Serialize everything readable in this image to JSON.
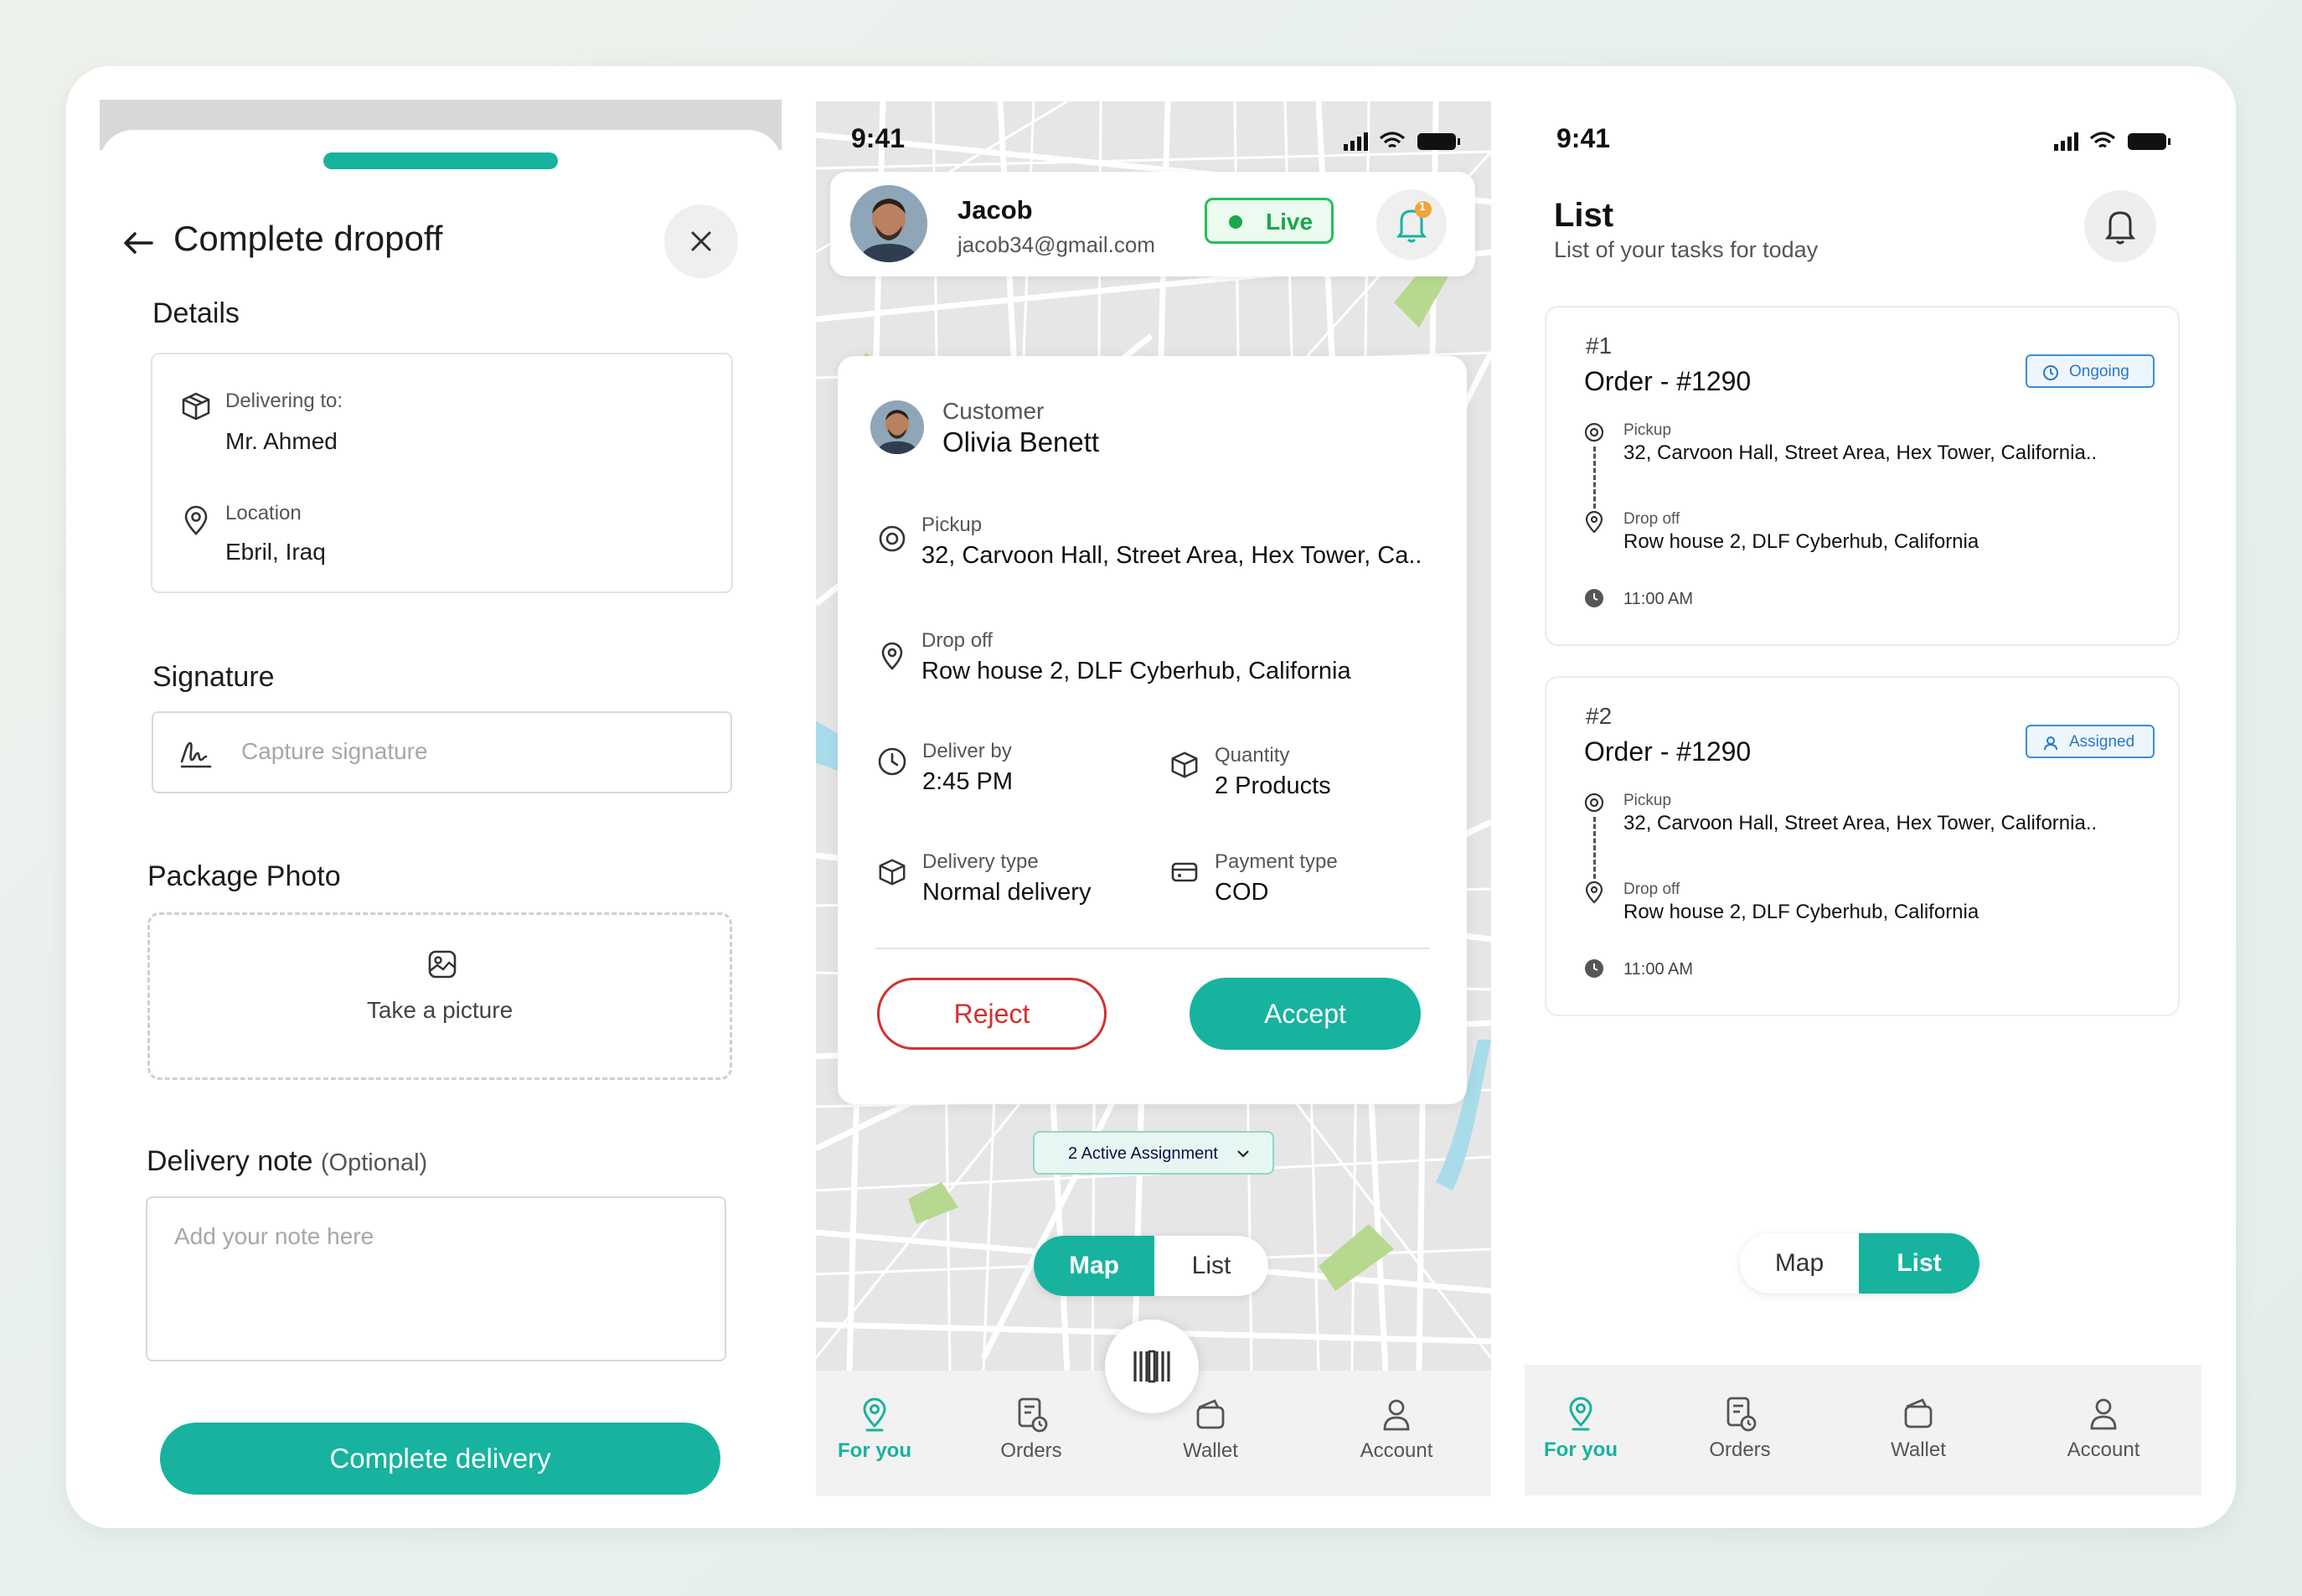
{
  "dropoff": {
    "title": "Complete dropoff",
    "details_heading": "Details",
    "delivering_to_label": "Delivering to:",
    "delivering_to_value": "Mr. Ahmed",
    "location_label": "Location",
    "location_value": "Ebril, Iraq",
    "signature_heading": "Signature",
    "signature_placeholder": "Capture signature",
    "photo_heading": "Package Photo",
    "photo_label": "Take a picture",
    "note_heading": "Delivery note",
    "note_optional": "(Optional)",
    "note_placeholder": "Add your note here",
    "complete_button": "Complete delivery"
  },
  "map_screen": {
    "status_time": "9:41",
    "driver_name": "Jacob",
    "driver_email": "jacob34@gmail.com",
    "live_label": "Live",
    "notification_count": "1",
    "customer_label": "Customer",
    "customer_name": "Olivia Benett",
    "pickup_label": "Pickup",
    "pickup_value": "32, Carvoon Hall, Street Area, Hex Tower, Ca..",
    "dropoff_label": "Drop off",
    "dropoff_value": "Row house 2, DLF Cyberhub, California",
    "deliver_by_label": "Deliver by",
    "deliver_by_value": "2:45 PM",
    "quantity_label": "Quantity",
    "quantity_value": "2 Products",
    "delivery_type_label": "Delivery type",
    "delivery_type_value": "Normal delivery",
    "payment_type_label": "Payment type",
    "payment_type_value": "COD",
    "reject_button": "Reject",
    "accept_button": "Accept",
    "active_assignment": "2 Active Assignment",
    "toggle_map": "Map",
    "toggle_list": "List"
  },
  "list_screen": {
    "status_time": "9:41",
    "title": "List",
    "subtitle": "List of your tasks for today",
    "toggle_map": "Map",
    "toggle_list": "List",
    "tasks": [
      {
        "num": "#1",
        "order": "Order - #1290",
        "status": "Ongoing",
        "pickup_label": "Pickup",
        "pickup_value": "32, Carvoon Hall, Street Area, Hex Tower, California..",
        "dropoff_label": "Drop off",
        "dropoff_value": "Row house 2, DLF Cyberhub, California",
        "time": "11:00 AM"
      },
      {
        "num": "#2",
        "order": "Order - #1290",
        "status": "Assigned",
        "pickup_label": "Pickup",
        "pickup_value": "32, Carvoon Hall, Street Area, Hex Tower, California..",
        "dropoff_label": "Drop off",
        "dropoff_value": "Row house 2, DLF Cyberhub, California",
        "time": "11:00 AM"
      }
    ]
  },
  "nav": {
    "for_you": "For you",
    "orders": "Orders",
    "wallet": "Wallet",
    "account": "Account"
  },
  "colors": {
    "accent": "#17b39f",
    "reject": "#d33030",
    "live": "#18a84a",
    "badge_blue": "#2a78c2"
  }
}
